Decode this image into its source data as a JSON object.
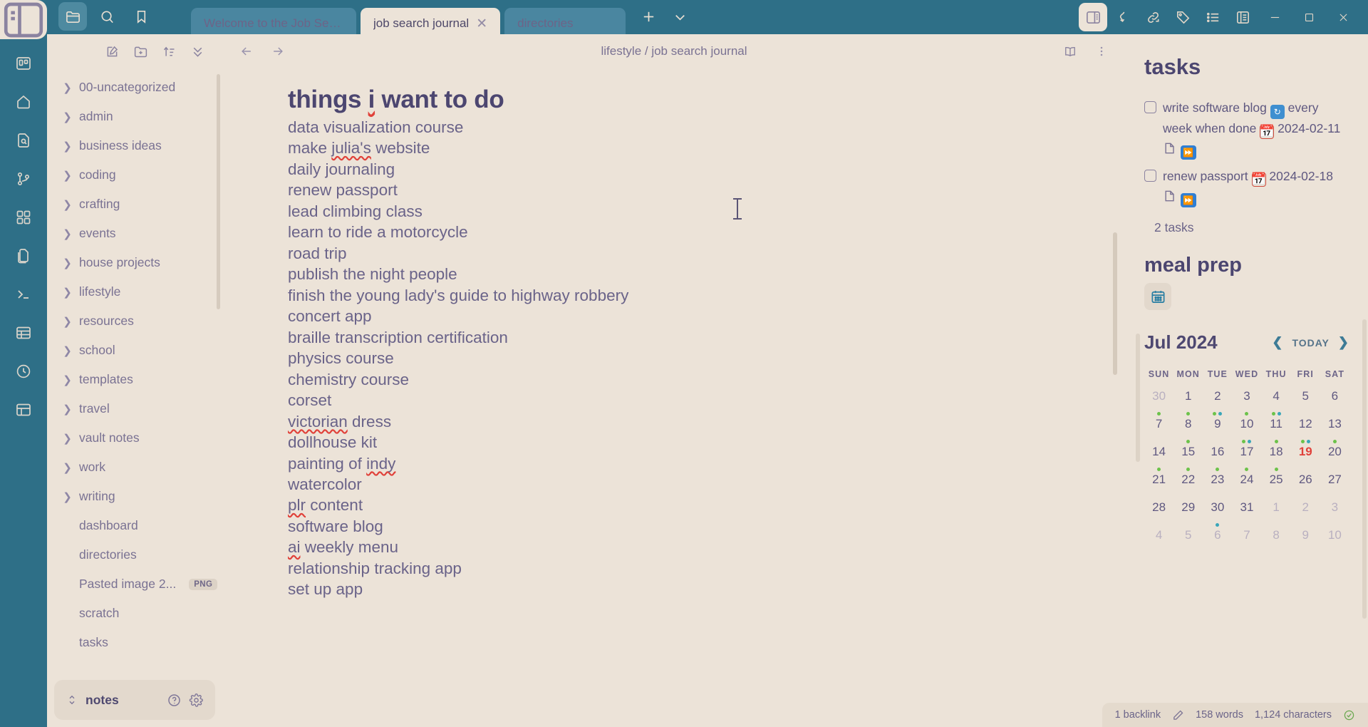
{
  "colors": {
    "titlebar": "#2e6f87",
    "panel": "#ece3d8",
    "accent_text": "#4c4670",
    "body_text": "#6a6389",
    "today_red": "#e0413a",
    "tab_inactive": "#4a86a0",
    "dot_green": "#6cc24a",
    "dot_teal": "#3aa6b9",
    "dot_olive": "#8fae3c"
  },
  "rail": {
    "top_icon": "sidebar-toggle-icon",
    "icons": [
      "trello-board-icon",
      "home-icon",
      "file-search-icon",
      "git-branch-icon",
      "grid-apps-icon",
      "files-icon",
      "terminal-icon",
      "table-icon",
      "clock-icon",
      "layout-icon"
    ]
  },
  "titlebar": {
    "tools": [
      {
        "name": "folder-icon",
        "active": true
      },
      {
        "name": "search-icon",
        "active": false
      },
      {
        "name": "bookmark-icon",
        "active": false
      }
    ],
    "tabs": [
      {
        "label": "Welcome to the Job Search J...",
        "active": false,
        "closable": false
      },
      {
        "label": "job search journal",
        "active": true,
        "closable": true
      },
      {
        "label": "directories",
        "active": false,
        "closable": false
      }
    ],
    "new_tab_label": "+",
    "tab_list_label": "chevron-down-icon",
    "right_icons": [
      {
        "name": "right-sidebar-toggle-icon",
        "active": true
      },
      {
        "name": "curved-arrow-icon",
        "active": false
      },
      {
        "name": "link-icon",
        "active": false
      },
      {
        "name": "tag-icon",
        "active": false
      },
      {
        "name": "list-icon",
        "active": false
      },
      {
        "name": "outline-icon",
        "active": false
      }
    ],
    "window_controls": [
      "minimize",
      "maximize",
      "close"
    ]
  },
  "explorer": {
    "toolbar_icons": [
      "new-note-icon",
      "new-folder-icon",
      "sort-icon",
      "collapse-all-icon"
    ],
    "items": [
      {
        "label": "00-uncategorized",
        "type": "folder"
      },
      {
        "label": "admin",
        "type": "folder"
      },
      {
        "label": "business ideas",
        "type": "folder"
      },
      {
        "label": "coding",
        "type": "folder"
      },
      {
        "label": "crafting",
        "type": "folder"
      },
      {
        "label": "events",
        "type": "folder"
      },
      {
        "label": "house projects",
        "type": "folder"
      },
      {
        "label": "lifestyle",
        "type": "folder"
      },
      {
        "label": "resources",
        "type": "folder"
      },
      {
        "label": "school",
        "type": "folder"
      },
      {
        "label": "templates",
        "type": "folder"
      },
      {
        "label": "travel",
        "type": "folder"
      },
      {
        "label": "vault notes",
        "type": "folder"
      },
      {
        "label": "work",
        "type": "folder"
      },
      {
        "label": "writing",
        "type": "folder"
      },
      {
        "label": "dashboard",
        "type": "file"
      },
      {
        "label": "directories",
        "type": "file"
      },
      {
        "label": "Pasted image 2...",
        "type": "file",
        "badge": "PNG"
      },
      {
        "label": "scratch",
        "type": "file"
      },
      {
        "label": "tasks",
        "type": "file"
      }
    ],
    "vault_name": "notes",
    "vault_icons": [
      "help-icon",
      "settings-gear-icon"
    ]
  },
  "editor": {
    "breadcrumb": "lifestyle / job search journal",
    "breadcrumb_parent": "lifestyle",
    "breadcrumb_current": "job search journal",
    "header_icons": [
      "reading-view-icon",
      "more-options-icon"
    ],
    "nav_icons": [
      "back-arrow-icon",
      "forward-arrow-icon"
    ],
    "title": "things i want to do",
    "title_parts": [
      {
        "text": "things ",
        "misspelled": false
      },
      {
        "text": "i",
        "misspelled": true
      },
      {
        "text": " want to do",
        "misspelled": false
      }
    ],
    "lines": [
      [
        {
          "text": "data visualization course",
          "misspelled": false
        }
      ],
      [
        {
          "text": "make ",
          "misspelled": false
        },
        {
          "text": "julia's",
          "misspelled": true
        },
        {
          "text": " website",
          "misspelled": false
        }
      ],
      [
        {
          "text": "daily journaling",
          "misspelled": false
        }
      ],
      [
        {
          "text": "renew passport",
          "misspelled": false
        }
      ],
      [
        {
          "text": "lead climbing class",
          "misspelled": false
        }
      ],
      [
        {
          "text": "learn to ride a motorcycle",
          "misspelled": false
        }
      ],
      [
        {
          "text": "road trip",
          "misspelled": false
        }
      ],
      [
        {
          "text": "publish the night people",
          "misspelled": false
        }
      ],
      [
        {
          "text": "finish the young lady's guide to highway robbery",
          "misspelled": false
        }
      ],
      [
        {
          "text": "concert app",
          "misspelled": false
        }
      ],
      [
        {
          "text": "braille transcription certification",
          "misspelled": false
        }
      ],
      [
        {
          "text": "physics course",
          "misspelled": false
        }
      ],
      [
        {
          "text": "chemistry course",
          "misspelled": false
        }
      ],
      [
        {
          "text": "corset",
          "misspelled": false
        }
      ],
      [
        {
          "text": "victorian",
          "misspelled": true
        },
        {
          "text": " dress",
          "misspelled": false
        }
      ],
      [
        {
          "text": "dollhouse kit",
          "misspelled": false
        }
      ],
      [
        {
          "text": "painting of ",
          "misspelled": false
        },
        {
          "text": "indy",
          "misspelled": true
        }
      ],
      [
        {
          "text": "watercolor",
          "misspelled": false
        }
      ],
      [
        {
          "text": "plr",
          "misspelled": true
        },
        {
          "text": " content",
          "misspelled": false
        }
      ],
      [
        {
          "text": "software blog",
          "misspelled": false
        }
      ],
      [
        {
          "text": "ai",
          "misspelled": true
        },
        {
          "text": " weekly menu",
          "misspelled": false
        }
      ],
      [
        {
          "text": "relationship tracking app",
          "misspelled": false
        }
      ],
      [
        {
          "text": "set up app",
          "misspelled": false
        }
      ]
    ]
  },
  "right_panel": {
    "title": "tasks",
    "tasks": [
      {
        "text_before": "write software blog",
        "repeat_text": "every week when done",
        "date": "2024-02-11",
        "repeat_icon": "repeat-icon",
        "date_icon": "calendar-icon",
        "note_icon": "note-icon",
        "forward_icon": "fast-forward-icon"
      },
      {
        "text_before": "renew passport",
        "repeat_text": "",
        "date": "2024-02-18",
        "repeat_icon": "",
        "date_icon": "calendar-icon",
        "note_icon": "note-icon",
        "forward_icon": "fast-forward-icon"
      }
    ],
    "task_count_label": "2 tasks",
    "section_two_title": "meal prep",
    "section_two_button_icon": "calendar-icon"
  },
  "calendar": {
    "month_label": "Jul 2024",
    "today_label": "TODAY",
    "prev_icon": "chevron-left-icon",
    "next_icon": "chevron-right-icon",
    "day_headers": [
      "SUN",
      "MON",
      "TUE",
      "WED",
      "THU",
      "FRI",
      "SAT"
    ],
    "weeks": [
      [
        {
          "d": "30",
          "dim": true,
          "today": false,
          "dots": [
            "#6cc24a"
          ]
        },
        {
          "d": "1",
          "dim": false,
          "today": false,
          "dots": [
            "#6cc24a"
          ]
        },
        {
          "d": "2",
          "dim": false,
          "today": false,
          "dots": [
            "#6cc24a",
            "#3aa6b9"
          ]
        },
        {
          "d": "3",
          "dim": false,
          "today": false,
          "dots": [
            "#6cc24a"
          ]
        },
        {
          "d": "4",
          "dim": false,
          "today": false,
          "dots": [
            "#6cc24a",
            "#3aa6b9"
          ]
        },
        {
          "d": "5",
          "dim": false,
          "today": false,
          "dots": []
        },
        {
          "d": "6",
          "dim": false,
          "today": false,
          "dots": []
        }
      ],
      [
        {
          "d": "7",
          "dim": false,
          "today": false,
          "dots": []
        },
        {
          "d": "8",
          "dim": false,
          "today": false,
          "dots": [
            "#6cc24a"
          ]
        },
        {
          "d": "9",
          "dim": false,
          "today": false,
          "dots": []
        },
        {
          "d": "10",
          "dim": false,
          "today": false,
          "dots": [
            "#6cc24a",
            "#3aa6b9"
          ]
        },
        {
          "d": "11",
          "dim": false,
          "today": false,
          "dots": [
            "#6cc24a"
          ]
        },
        {
          "d": "12",
          "dim": false,
          "today": false,
          "dots": [
            "#6cc24a",
            "#3aa6b9"
          ]
        },
        {
          "d": "13",
          "dim": false,
          "today": false,
          "dots": [
            "#6cc24a"
          ]
        }
      ],
      [
        {
          "d": "14",
          "dim": false,
          "today": false,
          "dots": [
            "#6cc24a"
          ]
        },
        {
          "d": "15",
          "dim": false,
          "today": false,
          "dots": [
            "#6cc24a"
          ]
        },
        {
          "d": "16",
          "dim": false,
          "today": false,
          "dots": [
            "#6cc24a"
          ]
        },
        {
          "d": "17",
          "dim": false,
          "today": false,
          "dots": [
            "#6cc24a"
          ]
        },
        {
          "d": "18",
          "dim": false,
          "today": false,
          "dots": [
            "#6cc24a"
          ]
        },
        {
          "d": "19",
          "dim": false,
          "today": true,
          "dots": []
        },
        {
          "d": "20",
          "dim": false,
          "today": false,
          "dots": []
        }
      ],
      [
        {
          "d": "21",
          "dim": false,
          "today": false,
          "dots": []
        },
        {
          "d": "22",
          "dim": false,
          "today": false,
          "dots": []
        },
        {
          "d": "23",
          "dim": false,
          "today": false,
          "dots": []
        },
        {
          "d": "24",
          "dim": false,
          "today": false,
          "dots": []
        },
        {
          "d": "25",
          "dim": false,
          "today": false,
          "dots": []
        },
        {
          "d": "26",
          "dim": false,
          "today": false,
          "dots": []
        },
        {
          "d": "27",
          "dim": false,
          "today": false,
          "dots": []
        }
      ],
      [
        {
          "d": "28",
          "dim": false,
          "today": false,
          "dots": []
        },
        {
          "d": "29",
          "dim": false,
          "today": false,
          "dots": []
        },
        {
          "d": "30",
          "dim": false,
          "today": false,
          "dots": [
            "#3aa6b9"
          ]
        },
        {
          "d": "31",
          "dim": false,
          "today": false,
          "dots": []
        },
        {
          "d": "1",
          "dim": true,
          "today": false,
          "dots": []
        },
        {
          "d": "2",
          "dim": true,
          "today": false,
          "dots": []
        },
        {
          "d": "3",
          "dim": true,
          "today": false,
          "dots": []
        }
      ],
      [
        {
          "d": "4",
          "dim": true,
          "today": false,
          "dots": []
        },
        {
          "d": "5",
          "dim": true,
          "today": false,
          "dots": []
        },
        {
          "d": "6",
          "dim": true,
          "today": false,
          "dots": []
        },
        {
          "d": "7",
          "dim": true,
          "today": false,
          "dots": []
        },
        {
          "d": "8",
          "dim": true,
          "today": false,
          "dots": []
        },
        {
          "d": "9",
          "dim": true,
          "today": false,
          "dots": []
        },
        {
          "d": "10",
          "dim": true,
          "today": false,
          "dots": []
        }
      ]
    ]
  },
  "statusbar": {
    "backlink_label": "1 backlink",
    "edit_icon": "pencil-icon",
    "word_count": "158 words",
    "char_count": "1,124 characters",
    "sync_icon": "sync-check-icon"
  }
}
